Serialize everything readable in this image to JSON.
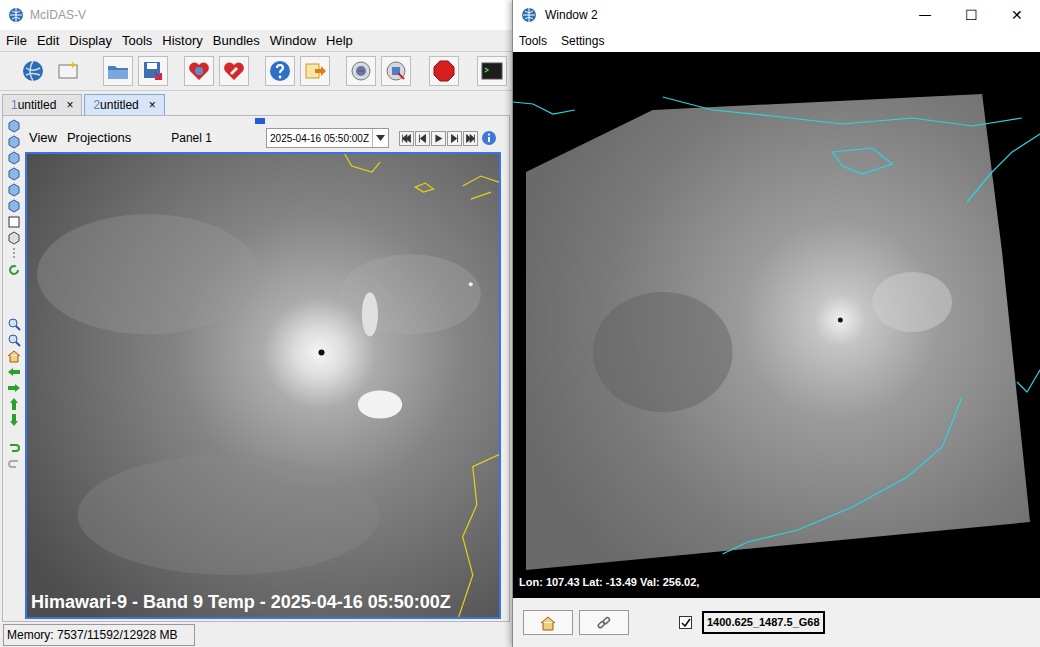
{
  "main_window": {
    "title": "McIDAS-V",
    "menu": [
      "File",
      "Edit",
      "Display",
      "Tools",
      "History",
      "Bundles",
      "Window",
      "Help"
    ],
    "tabs": [
      {
        "number": "1",
        "label": "untitled",
        "close": "×",
        "selected": false
      },
      {
        "number": "2",
        "label": "untitled",
        "close": "×",
        "selected": true
      }
    ],
    "panel": {
      "menu": [
        "View",
        "Projections"
      ],
      "title": "Panel 1",
      "time": "2025-04-16 05:50:00Z",
      "caption": "Himawari-9 - Band 9 Temp - 2025-04-16 05:50:00Z"
    },
    "status_bar": "Memory: 7537/11592/12928 MB"
  },
  "window2": {
    "title": "Window 2",
    "controls": [
      "—",
      "☐",
      "✕"
    ],
    "menu": [
      "Tools",
      "Settings"
    ],
    "readout": "Lon: 107.43 Lat: -13.49 Val: 256.02,",
    "layer": {
      "label": "1400.625_1487.5_G68",
      "checked": true
    }
  }
}
